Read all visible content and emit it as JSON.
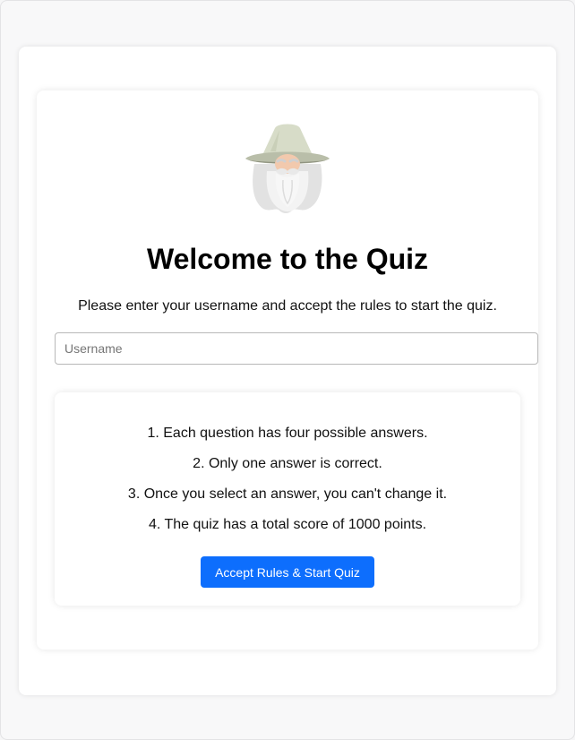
{
  "welcome": {
    "title": "Welcome to the Quiz",
    "intro": "Please enter your username and accept the rules to start the quiz.",
    "logo_icon": "wizard-icon"
  },
  "username": {
    "placeholder": "Username",
    "value": ""
  },
  "rules": {
    "items": [
      "1. Each question has four possible answers.",
      "2. Only one answer is correct.",
      "3. Once you select an answer, you can't change it.",
      "4. The quiz has a total score of 1000 points."
    ],
    "start_button_label": "Accept Rules & Start Quiz"
  },
  "colors": {
    "accent": "#0d6efd",
    "title": "#000000"
  }
}
